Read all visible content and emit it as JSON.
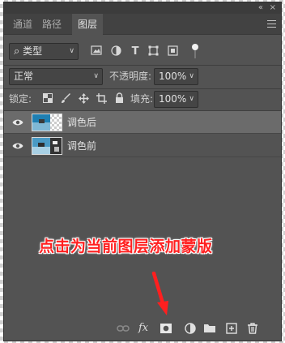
{
  "window": {
    "collapse_glyph": "«",
    "close_glyph": "×"
  },
  "tabs": [
    {
      "label": "通道",
      "active": false
    },
    {
      "label": "路径",
      "active": false
    },
    {
      "label": "图层",
      "active": true
    }
  ],
  "filter": {
    "label": "类型",
    "search_glyph": "⌕",
    "tool_icons": [
      "image-filter-icon",
      "adjustment-filter-icon",
      "type-filter-icon",
      "shape-filter-icon",
      "smart-object-filter-icon",
      "filter-toggle-icon"
    ]
  },
  "blend": {
    "mode": "正常",
    "opacity_label": "不透明度:",
    "opacity_value": "100%"
  },
  "lock": {
    "label": "锁定:",
    "fill_label": "填充:",
    "fill_value": "100%"
  },
  "layers": [
    {
      "name": "调色后",
      "selected": true,
      "visible": true
    },
    {
      "name": "调色前",
      "selected": false,
      "visible": true
    }
  ],
  "annotation": {
    "text": "点击为当前图层添加蒙版",
    "color": "#ff1f1f"
  },
  "bottom_tools": [
    "link-layers-icon",
    "fx-icon",
    "add-mask-icon",
    "adjustment-layer-icon",
    "group-folder-icon",
    "new-layer-icon",
    "delete-icon"
  ],
  "fx_label": "fx"
}
